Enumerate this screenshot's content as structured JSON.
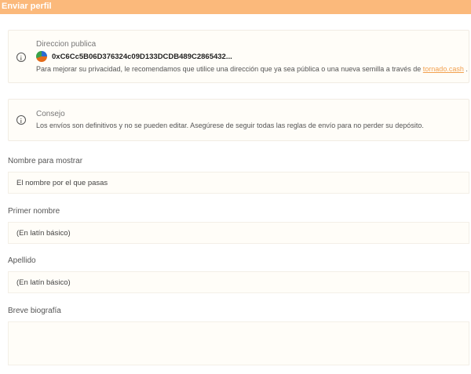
{
  "header": {
    "title": "Enviar perfil"
  },
  "public_address_card": {
    "title": "Direccion publica",
    "address": "0xC6Cc5B06D376324c09D133DCDB489C2865432...",
    "privacy_text": "Para mejorar su privacidad, le recomendamos que utilice una dirección que ya sea pública o una nueva semilla a través de",
    "link_text": "tornado.cash",
    "suffix": "."
  },
  "tip_card": {
    "title": "Consejo",
    "text": "Los envíos son definitivos y no se pueden editar. Asegúrese de seguir todas las reglas de envío para no perder su depósito."
  },
  "form": {
    "display_name_label": "Nombre para mostrar",
    "display_name_placeholder": "El nombre por el que pasas",
    "first_name_label": "Primer nombre",
    "first_name_placeholder": "(En latín básico)",
    "last_name_label": "Apellido",
    "last_name_placeholder": "(En latín básico)",
    "bio_label": "Breve biografía"
  }
}
